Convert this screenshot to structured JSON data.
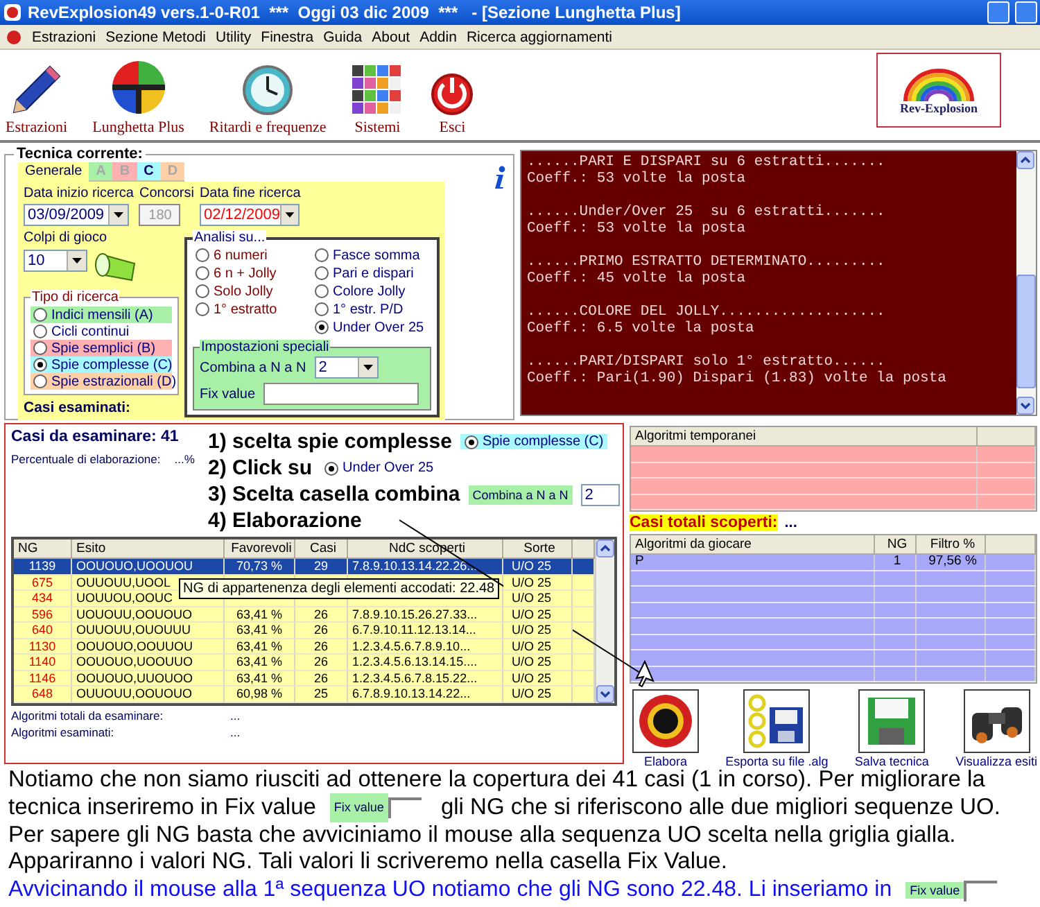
{
  "window": {
    "title": "RevExplosion49 vers.1-0-R01  ***  Oggi 03 dic 2009  ***   - [Sezione Lunghetta Plus]"
  },
  "menu": [
    "Estrazioni",
    "Sezione Metodi",
    "Utility",
    "Finestra",
    "Guida",
    "About",
    "Addin",
    "Ricerca aggiornamenti"
  ],
  "toolbar": [
    {
      "kind": "pencil",
      "label": "Estrazioni"
    },
    {
      "kind": "wheel",
      "label": "Lunghetta Plus"
    },
    {
      "kind": "clock",
      "label": "Ritardi e frequenze"
    },
    {
      "kind": "grid",
      "label": "Sistemi"
    },
    {
      "kind": "power",
      "label": "Esci"
    }
  ],
  "logo": {
    "text": "Rev-Explosion"
  },
  "tecnica": {
    "title": "Tecnica corrente:",
    "tabs": [
      {
        "label": "Generale",
        "selected": true,
        "enabled": true,
        "color": "#ffff99"
      },
      {
        "label": "A",
        "selected": false,
        "enabled": false,
        "color": "#a8f0a8"
      },
      {
        "label": "B",
        "selected": false,
        "enabled": false,
        "color": "#ffb0b0"
      },
      {
        "label": "C",
        "selected": false,
        "enabled": true,
        "color": "#a8f8ff"
      },
      {
        "label": "D",
        "selected": false,
        "enabled": false,
        "color": "#ffd0a8"
      }
    ],
    "data_inizio": {
      "label": "Data inizio ricerca",
      "value": "03/09/2009"
    },
    "concorsi": {
      "label": "Concorsi",
      "value": "180",
      "disabled": true
    },
    "data_fine": {
      "label": "Data fine ricerca",
      "value": "02/12/2009",
      "highlight": true
    },
    "colpi": {
      "label": "Colpi di gioco",
      "value": "10"
    },
    "tipo": {
      "title": "Tipo di ricerca",
      "options": [
        {
          "label": "Indici mensili (A)",
          "selected": false,
          "color": "#a8f0a8"
        },
        {
          "label": "Cicli continui",
          "selected": false,
          "color": "#ffffff"
        },
        {
          "label": "Spie semplici (B)",
          "selected": false,
          "color": "#ffb0b0"
        },
        {
          "label": "Spie complesse (C)",
          "selected": true,
          "color": "#a8f8ff"
        },
        {
          "label": "Spie estrazionali (D)",
          "selected": false,
          "color": "#ffd0a8"
        }
      ]
    },
    "analisi": {
      "title": "Analisi su...",
      "columns": [
        [
          {
            "label": "6 numeri",
            "selected": false,
            "color": "#800000"
          },
          {
            "label": "6 n + Jolly",
            "selected": false,
            "color": "#800000"
          },
          {
            "label": "Solo Jolly",
            "selected": false,
            "color": "#800000"
          },
          {
            "label": "1° estratto",
            "selected": false,
            "color": "#800000"
          }
        ],
        [
          {
            "label": "Fasce somma",
            "selected": false,
            "color": "#000080"
          },
          {
            "label": "Pari e dispari",
            "selected": false,
            "color": "#000080"
          },
          {
            "label": "Colore Jolly",
            "selected": false,
            "color": "#000080"
          },
          {
            "label": "1° estr. P/D",
            "selected": false,
            "color": "#000080"
          },
          {
            "label": "Under Over 25",
            "selected": true,
            "color": "#000080"
          }
        ]
      ]
    },
    "impostazioni": {
      "title": "Impostazioni speciali",
      "combina_label": "Combina a N a N",
      "combina_value": "2",
      "fix_label": "Fix value"
    },
    "casi_esaminati": "Casi esaminati:"
  },
  "console": [
    {
      "heading": "......PARI E DISPARI su 6 estratti.......",
      "coeff": "Coeff.: 53 volte la posta"
    },
    {
      "heading": "......Under/Over 25  su 6 estratti.......",
      "coeff": "Coeff.: 53 volte la posta"
    },
    {
      "heading": "......PRIMO ESTRATTO DETERMINATO.........",
      "coeff": "Coeff.: 45 volte la posta"
    },
    {
      "heading": "......COLORE DEL JOLLY...................",
      "coeff": "Coeff.: 6.5 volte la posta"
    },
    {
      "heading": "......PARI/DISPARI solo 1° estratto......",
      "coeff": "Coeff.: Pari(1.90) Dispari (1.83) volte la posta"
    }
  ],
  "elaborazione": {
    "casi": "Casi da esaminare: 41",
    "percent_label": "Percentuale di elaborazione:",
    "percent_value": "...%",
    "steps": [
      {
        "text": "1) scelta spie complesse",
        "widget": {
          "kind": "radio",
          "label": "Spie complesse (C)",
          "selected": true,
          "color": "#a8f8ff"
        }
      },
      {
        "text": "2) Click su",
        "widget": {
          "kind": "radio",
          "label": "Under Over 25",
          "selected": true,
          "color": "#ffffff"
        }
      },
      {
        "text": "3) Scelta casella combina",
        "widget": {
          "kind": "combo",
          "label": "Combina a N a N",
          "value": "2"
        }
      },
      {
        "text": "4) Elaborazione"
      }
    ],
    "grid": {
      "columns": [
        "NG",
        "Esito",
        "Favorevoli",
        "Casi",
        "NdC scoperti",
        "Sorte"
      ],
      "rows": [
        {
          "ng": "1139",
          "esito": "OOUOUO,UOOUOU",
          "favorevoli": "70,73 %",
          "casi": "29",
          "ndc": "7.8.9.10.13.14.22.26...",
          "sorte": "U/O 25",
          "selected": true
        },
        {
          "ng": "675",
          "esito": "OUUOUU,UOOL",
          "sorte": "U/O 25",
          "selected": false
        },
        {
          "ng": "434",
          "esito": "UOUUOU,OOUC",
          "sorte": "U/O 25",
          "selected": false
        },
        {
          "ng": "596",
          "esito": "UOUOUU,OOUOUO",
          "favorevoli": "63,41 %",
          "casi": "26",
          "ndc": "7.8.9.10.15.26.27.33...",
          "sorte": "U/O 25",
          "selected": false
        },
        {
          "ng": "640",
          "esito": "OUUOUU,OUOUUU",
          "favorevoli": "63,41 %",
          "casi": "26",
          "ndc": "6.7.9.10.11.12.13.14...",
          "sorte": "U/O 25",
          "selected": false
        },
        {
          "ng": "1130",
          "esito": "OOUOUO,OOUUOU",
          "favorevoli": "63,41 %",
          "casi": "26",
          "ndc": "1.2.3.4.5.6.7.8.9.10...",
          "sorte": "U/O 25",
          "selected": false
        },
        {
          "ng": "1140",
          "esito": "OOUOUO,UOOUUO",
          "favorevoli": "63,41 %",
          "casi": "26",
          "ndc": "1.2.3.4.5.6.13.14.15....",
          "sorte": "U/O 25",
          "selected": false
        },
        {
          "ng": "1146",
          "esito": "OOUOUO,UUOUOO",
          "favorevoli": "63,41 %",
          "casi": "26",
          "ndc": "1.2.3.4.5.6.7.8.15.22...",
          "sorte": "U/O 25",
          "selected": false
        },
        {
          "ng": "648",
          "esito": "OUUOUU,OOUOUO",
          "favorevoli": "60,98 %",
          "casi": "25",
          "ndc": "6.7.8.9.10.13.14.22...",
          "sorte": "U/O 25",
          "selected": false
        }
      ]
    },
    "tooltip": "NG di appartenenza degli elementi accodati: 22.48",
    "totals": [
      {
        "label": "Algoritmi totali da esaminare:",
        "value": "..."
      },
      {
        "label": "Algoritmi esaminati:",
        "value": "..."
      }
    ]
  },
  "temp_grid": {
    "columns": [
      "Algoritmi temporanei"
    ]
  },
  "casi_totali": {
    "label": "Casi totali scoperti:",
    "value": "..."
  },
  "play_grid": {
    "columns": [
      "Algoritmi da giocare",
      "NG",
      "Filtro %"
    ],
    "rows": [
      [
        "P",
        "1",
        "97,56 %"
      ]
    ]
  },
  "buttons": [
    {
      "kind": "target",
      "label": "Elabora"
    },
    {
      "kind": "export",
      "label": "Esporta su file .alg"
    },
    {
      "kind": "save",
      "label": "Salva tecnica"
    },
    {
      "kind": "binoculars",
      "label": "Visualizza esiti"
    }
  ],
  "note": {
    "before": "Notiamo che non siamo riusciti ad ottenere la copertura dei 41 casi (1 in corso). Per migliorare la tecnica inseriremo in Fix value",
    "field_label": "Fix value",
    "after": "gli NG che si riferiscono alle due migliori sequenze UO. Per sapere gli NG basta che avviciniamo il mouse alla sequenza UO scelta nella griglia gialla. Appariranno i valori NG. Tali valori li scriveremo nella casella Fix Value."
  },
  "highlight_line": {
    "text": "Avvicinando il mouse alla 1ª sequenza UO notiamo che gli NG sono 22.48. Li inseriamo in",
    "field_label": "Fix value"
  }
}
